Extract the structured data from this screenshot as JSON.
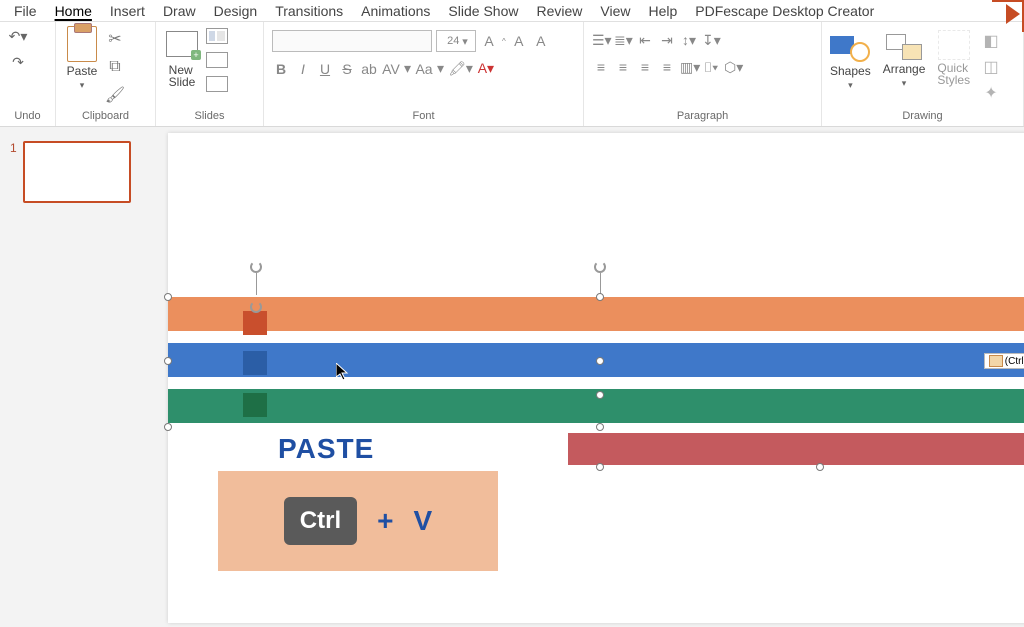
{
  "menu": {
    "items": [
      "File",
      "Home",
      "Insert",
      "Draw",
      "Design",
      "Transitions",
      "Animations",
      "Slide Show",
      "Review",
      "View",
      "Help",
      "PDFescape Desktop Creator"
    ],
    "active_index": 1
  },
  "ribbon": {
    "undo_label": "Undo",
    "clipboard": {
      "label": "Clipboard",
      "paste": "Paste"
    },
    "slides": {
      "label": "Slides",
      "new_slide": "New\nSlide"
    },
    "font": {
      "label": "Font",
      "size_display": "24"
    },
    "paragraph": {
      "label": "Paragraph"
    },
    "drawing": {
      "label": "Drawing",
      "shapes": "Shapes",
      "arrange": "Arrange",
      "quick": "Quick\nStyles"
    }
  },
  "thumbnails": [
    {
      "index": "1"
    }
  ],
  "paste_options_badge": "(Ctrl)",
  "hint": {
    "title": "PASTE",
    "key": "Ctrl",
    "plus": "+",
    "letter": "V"
  },
  "font_format": {
    "bold": "B",
    "italic": "I",
    "underline": "U",
    "strike": "S",
    "ab": "ab",
    "av": "AV",
    "aa": "Aa",
    "a_plus": "A",
    "a_minus": "A",
    "a_clear": "A"
  }
}
